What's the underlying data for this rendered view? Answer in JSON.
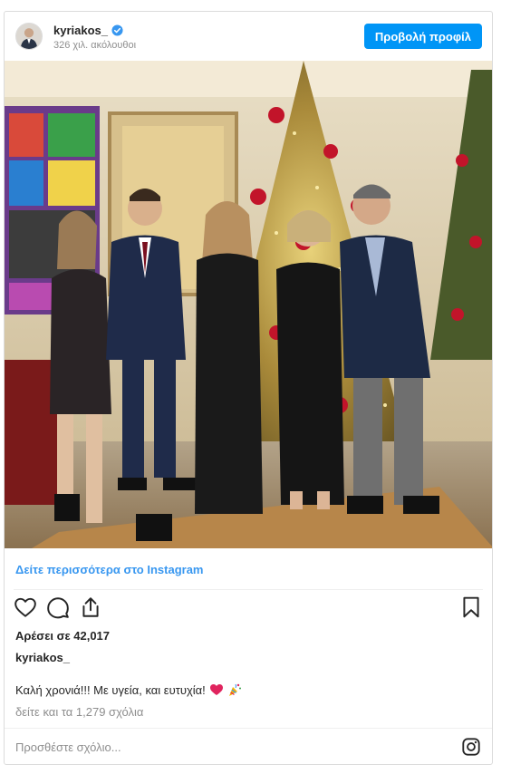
{
  "header": {
    "username": "kyriakos_",
    "verified": true,
    "followers": "326 χιλ. ακόλουθοι",
    "profile_button": "Προβολή προφίλ"
  },
  "photo": {
    "description_icon": "photo-image"
  },
  "more_link": "Δείτε περισσότερα στο Instagram",
  "actions": {
    "like_icon": "heart-icon",
    "comment_icon": "comment-icon",
    "share_icon": "share-icon",
    "save_icon": "bookmark-icon"
  },
  "likes": "Αρέσει σε 42,017",
  "post_user": "kyriakos_",
  "caption": "Καλή χρονιά!!! Με υγεία, και ευτυχία!",
  "comments_link": "δείτε και τα 1,279 σχόλια",
  "comment_placeholder": "Προσθέστε σχόλιο...",
  "colors": {
    "accent": "#0095f6",
    "link": "#3897f0",
    "muted": "#8e8e8e",
    "text": "#262626"
  }
}
